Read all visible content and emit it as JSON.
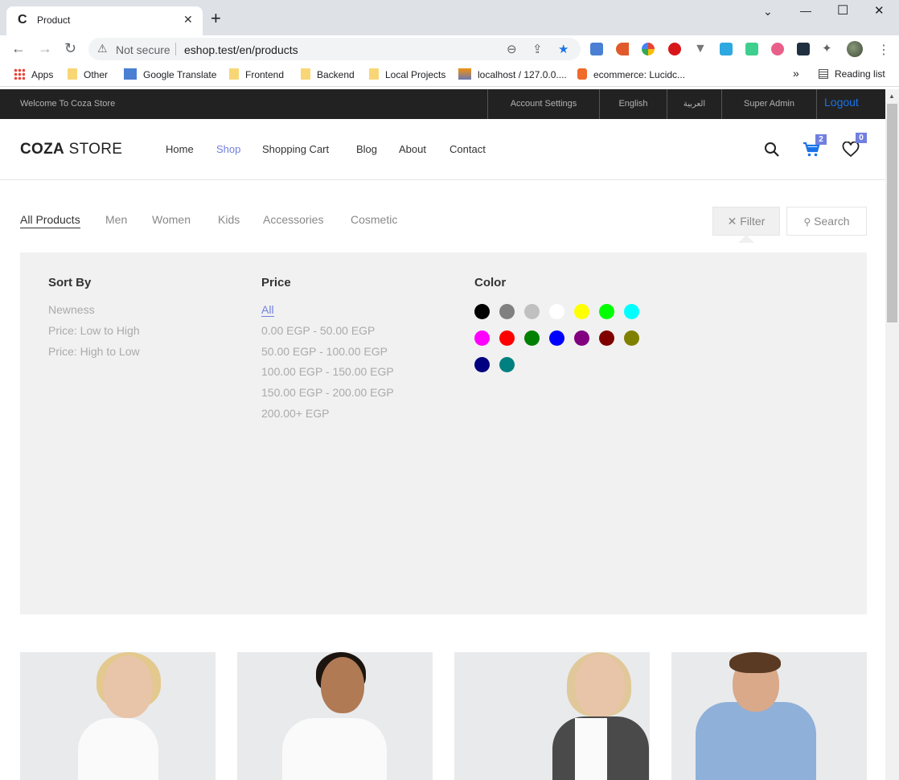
{
  "browser": {
    "tab_title": "Product",
    "tab_favicon": "C",
    "not_secure": "Not secure",
    "url": "eshop.test/en/products",
    "bookmarks": [
      {
        "label": "Apps",
        "icon": "apps-grid-icon"
      },
      {
        "label": "Other",
        "icon": "folder-icon"
      },
      {
        "label": "Google Translate",
        "icon": "google-translate-icon"
      },
      {
        "label": "Frontend",
        "icon": "folder-icon"
      },
      {
        "label": "Backend",
        "icon": "folder-icon"
      },
      {
        "label": "Local Projects",
        "icon": "folder-icon"
      },
      {
        "label": "localhost / 127.0.0....",
        "icon": "phpmyadmin-icon"
      },
      {
        "label": "ecommerce: Lucidc...",
        "icon": "lucid-icon"
      }
    ],
    "reading_list": "Reading list",
    "more_bookmarks": "»"
  },
  "site": {
    "welcome": "Welcome To Coza Store",
    "topbar": {
      "account": "Account Settings",
      "english": "English",
      "arabic": "العربية",
      "user": "Super Admin",
      "logout": "Logout"
    },
    "logo_bold": "COZA",
    "logo_rest": " STORE",
    "nav": [
      "Home",
      "Shop",
      "Shopping Cart",
      "Blog",
      "About",
      "Contact"
    ],
    "active_nav": "Shop",
    "cart_count": "2",
    "wishlist_count": "0",
    "filter_tabs": [
      "All Products",
      "Men",
      "Women",
      "Kids",
      "Accessories",
      "Cosmetic"
    ],
    "filter_btn": "Filter",
    "search_btn": "Search",
    "filter_btn_icon": "close-icon",
    "search_btn_icon": "search-icon",
    "panel": {
      "sort_title": "Sort By",
      "sort_options": [
        "Newness",
        "Price: Low to High",
        "Price: High to Low"
      ],
      "price_title": "Price",
      "price_options": [
        "All",
        "0.00 EGP - 50.00 EGP",
        "50.00 EGP - 100.00 EGP",
        "100.00 EGP - 150.00 EGP",
        "150.00 EGP - 200.00 EGP",
        "200.00+ EGP"
      ],
      "color_title": "Color",
      "colors": [
        "#000000",
        "#808080",
        "#c0c0c0",
        "#ffffff",
        "#ffff00",
        "#00ff00",
        "#00ffff",
        "#ff00ff",
        "#ff0000",
        "#008000",
        "#0000ff",
        "#800080",
        "#800000",
        "#808000",
        "#000080",
        "#008080"
      ]
    },
    "accent_color": "#717fe0"
  }
}
